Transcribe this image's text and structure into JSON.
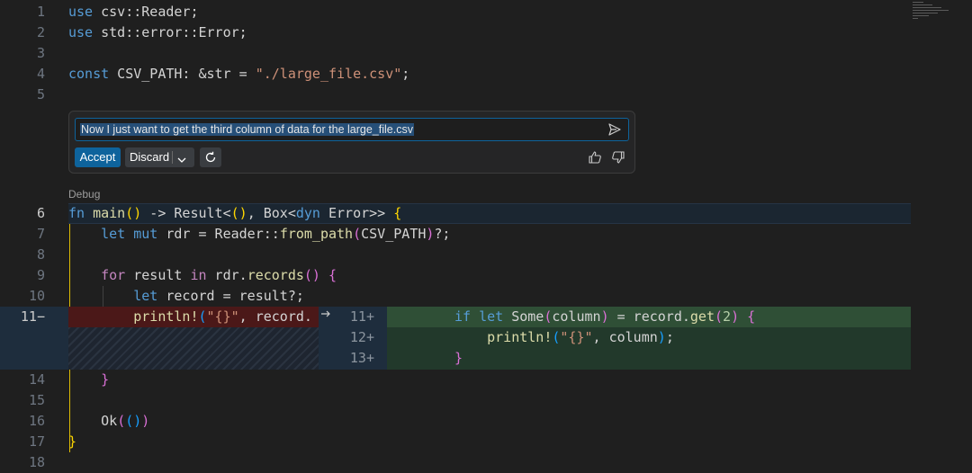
{
  "editor": {
    "lines": [
      {
        "num": "1",
        "parts": [
          [
            "kw",
            "use"
          ],
          [
            "p",
            " csv::Reader;"
          ]
        ]
      },
      {
        "num": "2",
        "parts": [
          [
            "kw",
            "use"
          ],
          [
            "p",
            " std::error::Error;"
          ]
        ]
      },
      {
        "num": "3",
        "parts": []
      },
      {
        "num": "4",
        "parts": [
          [
            "kw",
            "const"
          ],
          [
            "p",
            " CSV_PATH: &str = "
          ],
          [
            "str",
            "\"./large_file.csv\""
          ],
          [
            "p",
            ";"
          ]
        ]
      },
      {
        "num": "5",
        "parts": []
      },
      {
        "num": "6",
        "parts": [
          [
            "kw",
            "fn"
          ],
          [
            "p",
            " "
          ],
          [
            "fn",
            "main"
          ],
          [
            "br1",
            "()"
          ],
          [
            "p",
            " -> Result<"
          ],
          [
            "br1",
            "()"
          ],
          [
            "p",
            ", Box<"
          ],
          [
            "kw",
            "dyn"
          ],
          [
            "p",
            " Error>> "
          ],
          [
            "br1",
            "{"
          ]
        ]
      },
      {
        "num": "7",
        "parts": [
          [
            "p",
            "    "
          ],
          [
            "kw",
            "let"
          ],
          [
            "p",
            " "
          ],
          [
            "kw",
            "mut"
          ],
          [
            "p",
            " rdr = Reader::"
          ],
          [
            "fn",
            "from_path"
          ],
          [
            "br2",
            "("
          ],
          [
            "p",
            "CSV_PATH"
          ],
          [
            "br2",
            ")"
          ],
          [
            "p",
            "?;"
          ]
        ]
      },
      {
        "num": "8",
        "parts": []
      },
      {
        "num": "9",
        "parts": [
          [
            "p",
            "    "
          ],
          [
            "kw2",
            "for"
          ],
          [
            "p",
            " result "
          ],
          [
            "kw2",
            "in"
          ],
          [
            "p",
            " rdr."
          ],
          [
            "fn",
            "records"
          ],
          [
            "br2",
            "()"
          ],
          [
            "p",
            " "
          ],
          [
            "br2",
            "{"
          ]
        ]
      },
      {
        "num": "10",
        "parts": [
          [
            "p",
            "        "
          ],
          [
            "kw",
            "let"
          ],
          [
            "p",
            " record = result?;"
          ]
        ]
      },
      {
        "num": "14",
        "parts": [
          [
            "p",
            "    "
          ],
          [
            "br2",
            "}"
          ]
        ]
      },
      {
        "num": "15",
        "parts": []
      },
      {
        "num": "16",
        "parts": [
          [
            "p",
            "    Ok"
          ],
          [
            "br2",
            "("
          ],
          [
            "br3",
            "()"
          ],
          [
            "br2",
            ")"
          ]
        ]
      },
      {
        "num": "17",
        "parts": [
          [
            "br1",
            "}"
          ]
        ]
      },
      {
        "num": "18",
        "parts": []
      }
    ],
    "debug_label": "Debug"
  },
  "diff": {
    "original": {
      "num": "11",
      "marker": "−",
      "parts": [
        [
          "p",
          "        "
        ],
        [
          "fn",
          "println!"
        ],
        [
          "br3",
          "("
        ],
        [
          "str",
          "\"{}\""
        ],
        [
          "p",
          ", record."
        ]
      ]
    },
    "modified": [
      {
        "num": "11",
        "marker": "+",
        "parts": [
          [
            "kw",
            "if"
          ],
          [
            "p",
            " "
          ],
          [
            "kw",
            "let"
          ],
          [
            "p",
            " Some"
          ],
          [
            "br2",
            "("
          ],
          [
            "p",
            "column"
          ],
          [
            "br2",
            ")"
          ],
          [
            "p",
            " = record."
          ],
          [
            "fn",
            "get"
          ],
          [
            "br2",
            "("
          ],
          [
            "num",
            "2"
          ],
          [
            "br2",
            ")"
          ],
          [
            "p",
            " "
          ],
          [
            "br2",
            "{"
          ]
        ]
      },
      {
        "num": "12",
        "marker": "+",
        "parts": [
          [
            "p",
            "    "
          ],
          [
            "fn",
            "println!"
          ],
          [
            "br3",
            "("
          ],
          [
            "str",
            "\"{}\""
          ],
          [
            "p",
            ", column"
          ],
          [
            "br3",
            ")"
          ],
          [
            "p",
            ";"
          ]
        ]
      },
      {
        "num": "13",
        "marker": "+",
        "parts": [
          [
            "br2",
            "}"
          ]
        ]
      }
    ]
  },
  "inline_chat": {
    "prompt": "Now I just want to get the third column of data for the large_file.csv",
    "accept_label": "Accept",
    "discard_label": "Discard"
  }
}
